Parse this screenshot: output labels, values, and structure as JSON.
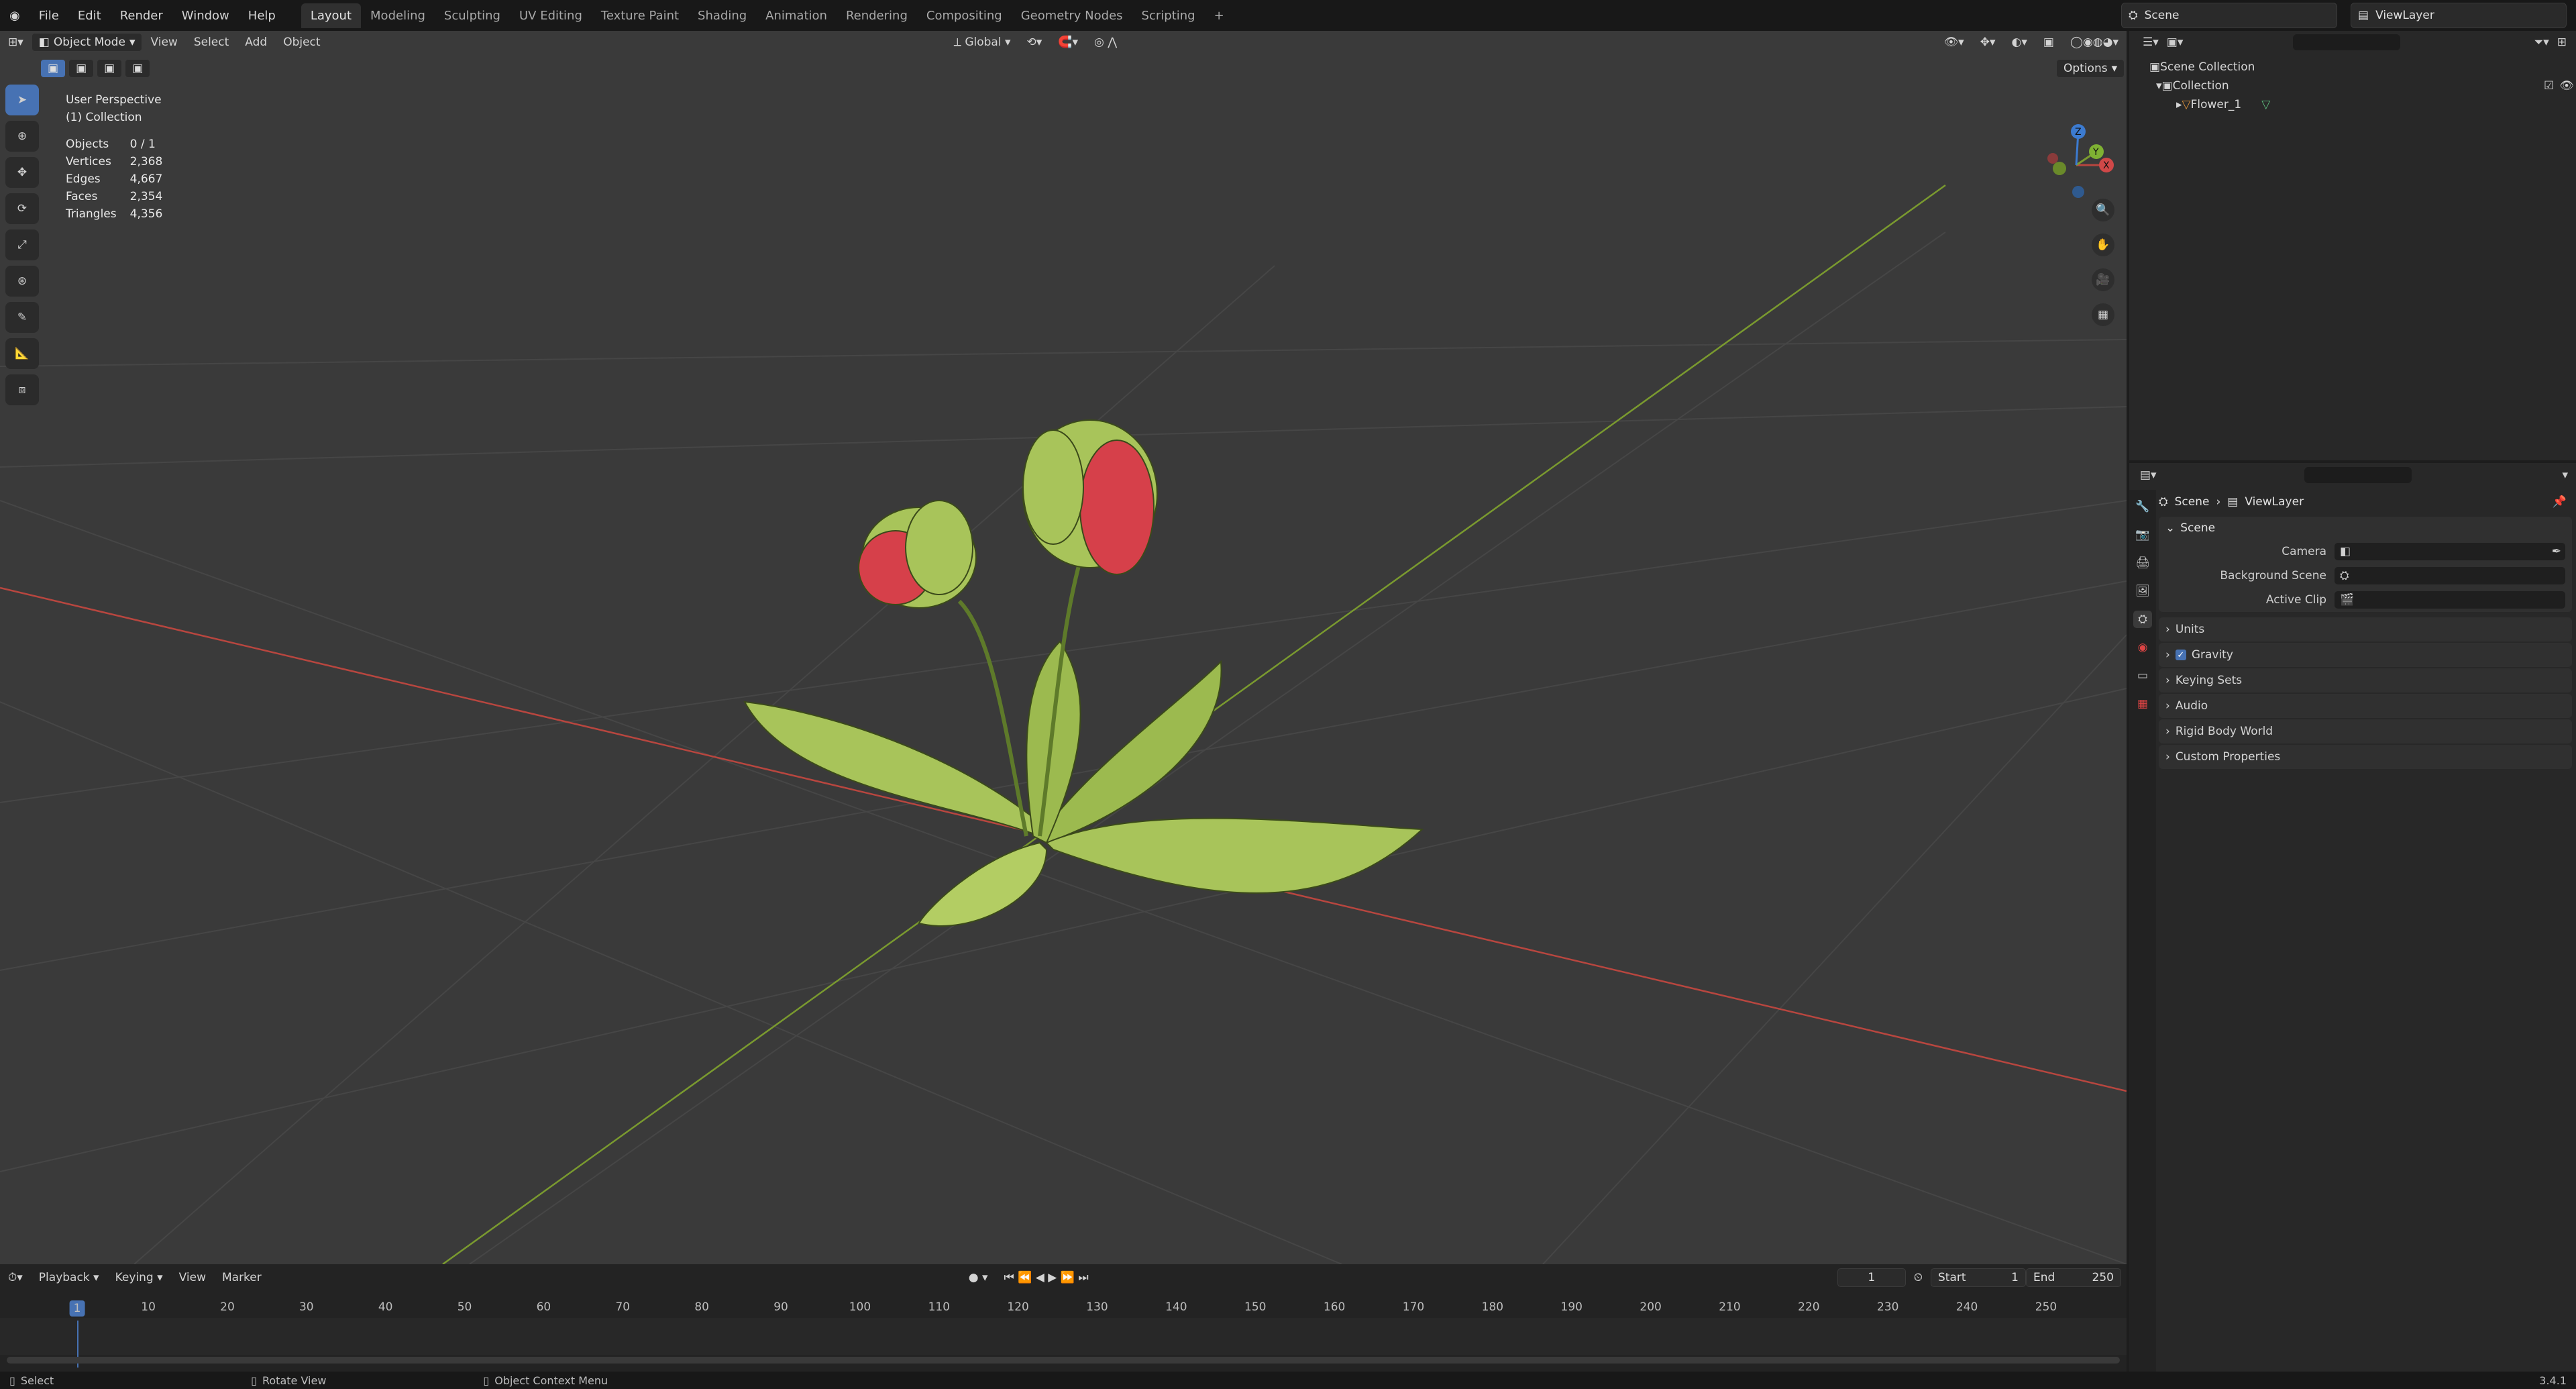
{
  "menu": [
    "File",
    "Edit",
    "Render",
    "Window",
    "Help"
  ],
  "workspaces": [
    "Layout",
    "Modeling",
    "Sculpting",
    "UV Editing",
    "Texture Paint",
    "Shading",
    "Animation",
    "Rendering",
    "Compositing",
    "Geometry Nodes",
    "Scripting"
  ],
  "active_workspace": "Layout",
  "scene_name": "Scene",
  "view_layer": "ViewLayer",
  "viewport": {
    "mode": "Object Mode",
    "menus": [
      "View",
      "Select",
      "Add",
      "Object"
    ],
    "transform_orientation": "Global",
    "options_label": "Options",
    "perspective_label": "User Perspective",
    "collection_label": "(1) Collection",
    "stats": [
      {
        "label": "Objects",
        "value": "0 / 1"
      },
      {
        "label": "Vertices",
        "value": "2,368"
      },
      {
        "label": "Edges",
        "value": "4,667"
      },
      {
        "label": "Faces",
        "value": "2,354"
      },
      {
        "label": "Triangles",
        "value": "4,356"
      }
    ],
    "gizmo_axes": [
      "X",
      "Y",
      "Z"
    ]
  },
  "timeline": {
    "menus": [
      "Playback",
      "Keying",
      "View",
      "Marker"
    ],
    "current_frame": "1",
    "start_label": "Start",
    "start_value": "1",
    "end_label": "End",
    "end_value": "250",
    "ruler": [
      "1",
      "10",
      "20",
      "30",
      "40",
      "50",
      "60",
      "70",
      "80",
      "90",
      "100",
      "110",
      "120",
      "130",
      "140",
      "150",
      "160",
      "170",
      "180",
      "190",
      "200",
      "210",
      "220",
      "230",
      "240",
      "250"
    ]
  },
  "status": {
    "items": [
      "Select",
      "Rotate View",
      "Object Context Menu"
    ],
    "version": "3.4.1"
  },
  "outliner": {
    "rows": [
      "Scene Collection",
      "Collection",
      "Flower_1"
    ]
  },
  "properties": {
    "breadcrumb": [
      "Scene",
      "ViewLayer"
    ],
    "panel_title": "Scene",
    "fields": [
      {
        "label": "Camera"
      },
      {
        "label": "Background Scene"
      },
      {
        "label": "Active Clip"
      }
    ],
    "subpanels": [
      "Units",
      "Gravity",
      "Keying Sets",
      "Audio",
      "Rigid Body World",
      "Custom Properties"
    ]
  },
  "colors": {
    "accent": "#4772b3",
    "viewport_bg": "#3a3a3a",
    "x_axis": "#b8463f",
    "y_axis": "#7a9a2f",
    "leaf": "#a8c45a",
    "trap_inner": "#d6404a"
  }
}
